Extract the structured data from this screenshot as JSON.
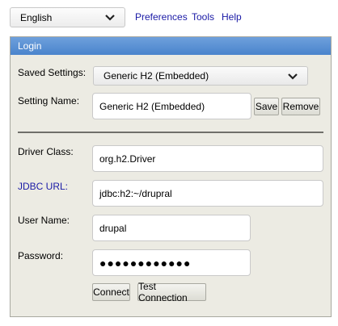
{
  "topbar": {
    "language": "English",
    "links": [
      "Preferences",
      "Tools",
      "Help"
    ]
  },
  "panel": {
    "title": "Login",
    "saved_settings_label": "Saved Settings:",
    "saved_settings_value": "Generic H2 (Embedded)",
    "setting_name_label": "Setting Name:",
    "setting_name_value": "Generic H2 (Embedded)",
    "save_label": "Save",
    "remove_label": "Remove",
    "driver_class_label": "Driver Class:",
    "driver_class_value": "org.h2.Driver",
    "jdbc_url_label": "JDBC URL:",
    "jdbc_url_value": "jdbc:h2:~/drupral",
    "user_name_label": "User Name:",
    "user_name_value": "drupal",
    "password_label": "Password:",
    "password_value": "●●●●●●●●●●●●",
    "connect_label": "Connect",
    "test_connection_label": "Test Connection"
  },
  "colors": {
    "header": "#5b90d4",
    "panel_bg": "#ecebe3",
    "link": "#1a1aa6"
  },
  "icons": [
    "chevron-down-icon"
  ]
}
